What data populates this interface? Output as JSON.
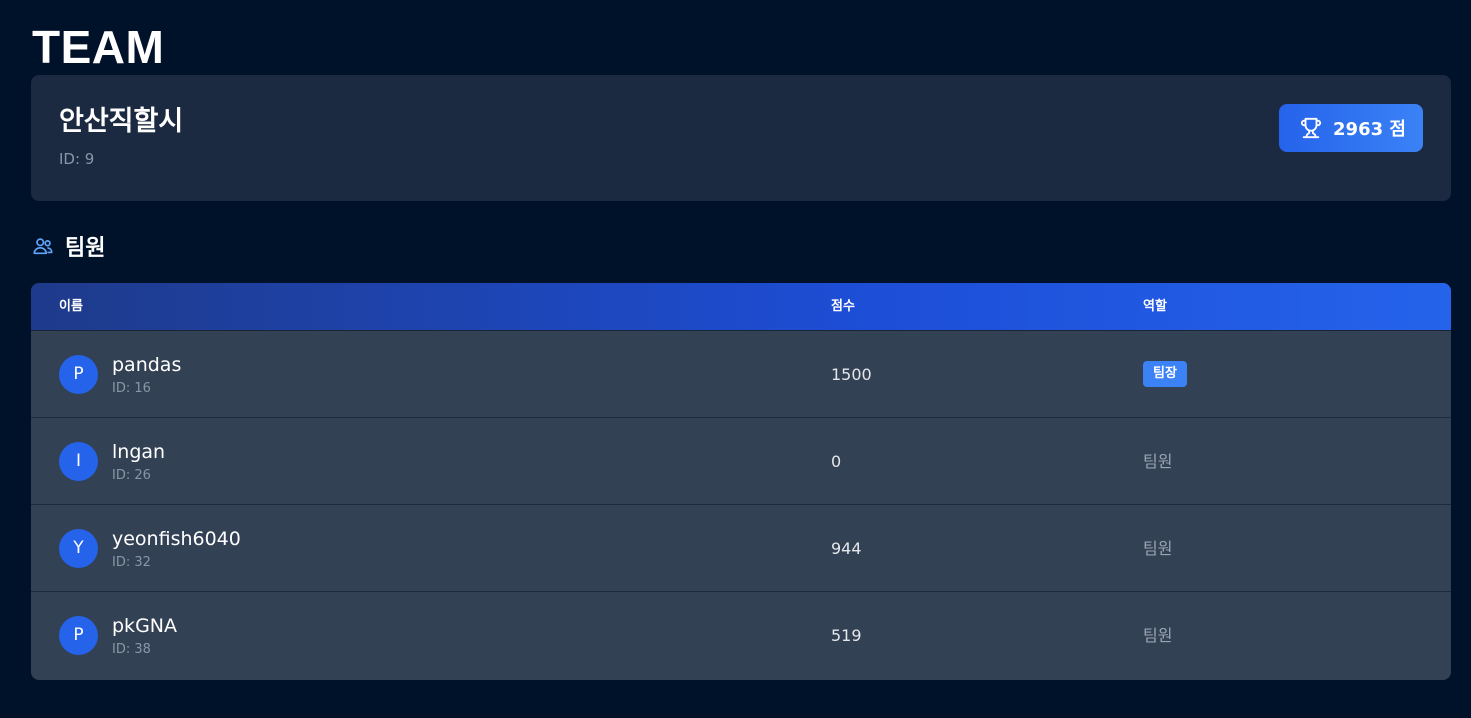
{
  "page": {
    "title": "TEAM"
  },
  "team": {
    "name": "안산직할시",
    "id_label": "ID: 9",
    "score_label": "2963 점"
  },
  "icons": {
    "score": "trophy-icon",
    "section": "users-icon"
  },
  "members_section": {
    "title": "팀원"
  },
  "table": {
    "headers": {
      "name": "이름",
      "score": "점수",
      "role": "역할"
    },
    "rows": [
      {
        "initial": "P",
        "name": "pandas",
        "id_label": "ID: 16",
        "score": "1500",
        "role": "팀장"
      },
      {
        "initial": "I",
        "name": "lngan",
        "id_label": "ID: 26",
        "score": "0",
        "role": "팀원"
      },
      {
        "initial": "Y",
        "name": "yeonfish6040",
        "id_label": "ID: 32",
        "score": "944",
        "role": "팀원"
      },
      {
        "initial": "P",
        "name": "pkGNA",
        "id_label": "ID: 38",
        "score": "519",
        "role": "팀원"
      }
    ]
  },
  "colors": {
    "background": "#00112a",
    "card": "#1b2941",
    "table_row": "#334155",
    "accent": "#2563eb",
    "leader_badge": "#3b82f6"
  }
}
